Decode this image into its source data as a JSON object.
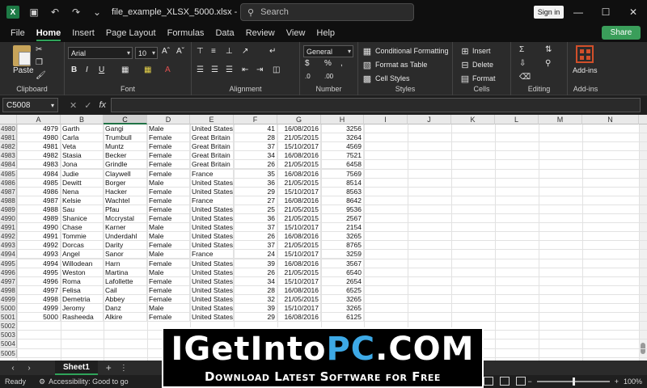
{
  "window": {
    "app_icon": "X",
    "title": "file_example_XLSX_5000.xlsx  -  Excel",
    "search_placeholder": "Search",
    "sign_in": "Sign in"
  },
  "tabs": [
    "File",
    "Home",
    "Insert",
    "Page Layout",
    "Formulas",
    "Data",
    "Review",
    "View",
    "Help"
  ],
  "active_tab": "Home",
  "share_label": "Share",
  "ribbon": {
    "clipboard": {
      "label": "Clipboard",
      "paste": "Paste"
    },
    "font": {
      "label": "Font",
      "font_name": "Arial",
      "font_size": "10"
    },
    "alignment": {
      "label": "Alignment"
    },
    "number": {
      "label": "Number",
      "format": "General"
    },
    "styles": {
      "label": "Styles",
      "conditional": "Conditional Formatting",
      "format_table": "Format as Table",
      "cell_styles": "Cell Styles"
    },
    "cells": {
      "label": "Cells",
      "insert": "Insert",
      "delete": "Delete",
      "format": "Format"
    },
    "editing": {
      "label": "Editing"
    },
    "addins": {
      "label": "Add-ins",
      "button": "Add-ins"
    }
  },
  "formula_bar": {
    "name_box": "C5008",
    "fx": "fx",
    "value": ""
  },
  "columns": [
    "A",
    "B",
    "C",
    "D",
    "E",
    "F",
    "G",
    "H",
    "I",
    "J",
    "K",
    "L",
    "M",
    "N"
  ],
  "selected_column": "C",
  "rows": [
    {
      "r": "4980",
      "a": "4979",
      "b": "Garth",
      "c": "Gangi",
      "d": "Male",
      "e": "United States",
      "f": "41",
      "g": "16/08/2016",
      "h": "3256"
    },
    {
      "r": "4981",
      "a": "4980",
      "b": "Carla",
      "c": "Trumbull",
      "d": "Female",
      "e": "Great Britain",
      "f": "28",
      "g": "21/05/2015",
      "h": "3264"
    },
    {
      "r": "4982",
      "a": "4981",
      "b": "Veta",
      "c": "Muntz",
      "d": "Female",
      "e": "Great Britain",
      "f": "37",
      "g": "15/10/2017",
      "h": "4569"
    },
    {
      "r": "4983",
      "a": "4982",
      "b": "Stasia",
      "c": "Becker",
      "d": "Female",
      "e": "Great Britain",
      "f": "34",
      "g": "16/08/2016",
      "h": "7521"
    },
    {
      "r": "4984",
      "a": "4983",
      "b": "Jona",
      "c": "Grindle",
      "d": "Female",
      "e": "Great Britain",
      "f": "26",
      "g": "21/05/2015",
      "h": "6458"
    },
    {
      "r": "4985",
      "a": "4984",
      "b": "Judie",
      "c": "Claywell",
      "d": "Female",
      "e": "France",
      "f": "35",
      "g": "16/08/2016",
      "h": "7569"
    },
    {
      "r": "4986",
      "a": "4985",
      "b": "Dewitt",
      "c": "Borger",
      "d": "Male",
      "e": "United States",
      "f": "36",
      "g": "21/05/2015",
      "h": "8514"
    },
    {
      "r": "4987",
      "a": "4986",
      "b": "Nena",
      "c": "Hacker",
      "d": "Female",
      "e": "United States",
      "f": "29",
      "g": "15/10/2017",
      "h": "8563"
    },
    {
      "r": "4988",
      "a": "4987",
      "b": "Kelsie",
      "c": "Wachtel",
      "d": "Female",
      "e": "France",
      "f": "27",
      "g": "16/08/2016",
      "h": "8642"
    },
    {
      "r": "4989",
      "a": "4988",
      "b": "Sau",
      "c": "Pfau",
      "d": "Female",
      "e": "United States",
      "f": "25",
      "g": "21/05/2015",
      "h": "9536"
    },
    {
      "r": "4990",
      "a": "4989",
      "b": "Shanice",
      "c": "Mccrystal",
      "d": "Female",
      "e": "United States",
      "f": "36",
      "g": "21/05/2015",
      "h": "2567"
    },
    {
      "r": "4991",
      "a": "4990",
      "b": "Chase",
      "c": "Karner",
      "d": "Male",
      "e": "United States",
      "f": "37",
      "g": "15/10/2017",
      "h": "2154"
    },
    {
      "r": "4992",
      "a": "4991",
      "b": "Tommie",
      "c": "Underdahl",
      "d": "Male",
      "e": "United States",
      "f": "26",
      "g": "16/08/2016",
      "h": "3265"
    },
    {
      "r": "4993",
      "a": "4992",
      "b": "Dorcas",
      "c": "Darity",
      "d": "Female",
      "e": "United States",
      "f": "37",
      "g": "21/05/2015",
      "h": "8765"
    },
    {
      "r": "4994",
      "a": "4993",
      "b": "Angel",
      "c": "Sanor",
      "d": "Male",
      "e": "France",
      "f": "24",
      "g": "15/10/2017",
      "h": "3259"
    },
    {
      "r": "4995",
      "a": "4994",
      "b": "Willodean",
      "c": "Harn",
      "d": "Female",
      "e": "United States",
      "f": "39",
      "g": "16/08/2016",
      "h": "3567"
    },
    {
      "r": "4996",
      "a": "4995",
      "b": "Weston",
      "c": "Martina",
      "d": "Male",
      "e": "United States",
      "f": "26",
      "g": "21/05/2015",
      "h": "6540"
    },
    {
      "r": "4997",
      "a": "4996",
      "b": "Roma",
      "c": "Lafollette",
      "d": "Female",
      "e": "United States",
      "f": "34",
      "g": "15/10/2017",
      "h": "2654"
    },
    {
      "r": "4998",
      "a": "4997",
      "b": "Felisa",
      "c": "Cail",
      "d": "Female",
      "e": "United States",
      "f": "28",
      "g": "16/08/2016",
      "h": "6525"
    },
    {
      "r": "4999",
      "a": "4998",
      "b": "Demetria",
      "c": "Abbey",
      "d": "Female",
      "e": "United States",
      "f": "32",
      "g": "21/05/2015",
      "h": "3265"
    },
    {
      "r": "5000",
      "a": "4999",
      "b": "Jeromy",
      "c": "Danz",
      "d": "Male",
      "e": "United States",
      "f": "39",
      "g": "15/10/2017",
      "h": "3265"
    },
    {
      "r": "5001",
      "a": "5000",
      "b": "Rasheeda",
      "c": "Alkire",
      "d": "Female",
      "e": "United States",
      "f": "29",
      "g": "16/08/2016",
      "h": "6125"
    },
    {
      "r": "5002"
    },
    {
      "r": "5003"
    },
    {
      "r": "5004"
    },
    {
      "r": "5005"
    }
  ],
  "sheet_tab": "Sheet1",
  "status": {
    "ready": "Ready",
    "accessibility": "Accessibility: Good to go",
    "zoom": "100%"
  },
  "watermark": {
    "part1": "IGetInto",
    "part2": "PC",
    "part3": ".COM",
    "subtitle": "Download Latest Software for Free"
  },
  "colors": {
    "accent": "#2fa35a",
    "watermark_blue": "#3da9e6"
  }
}
